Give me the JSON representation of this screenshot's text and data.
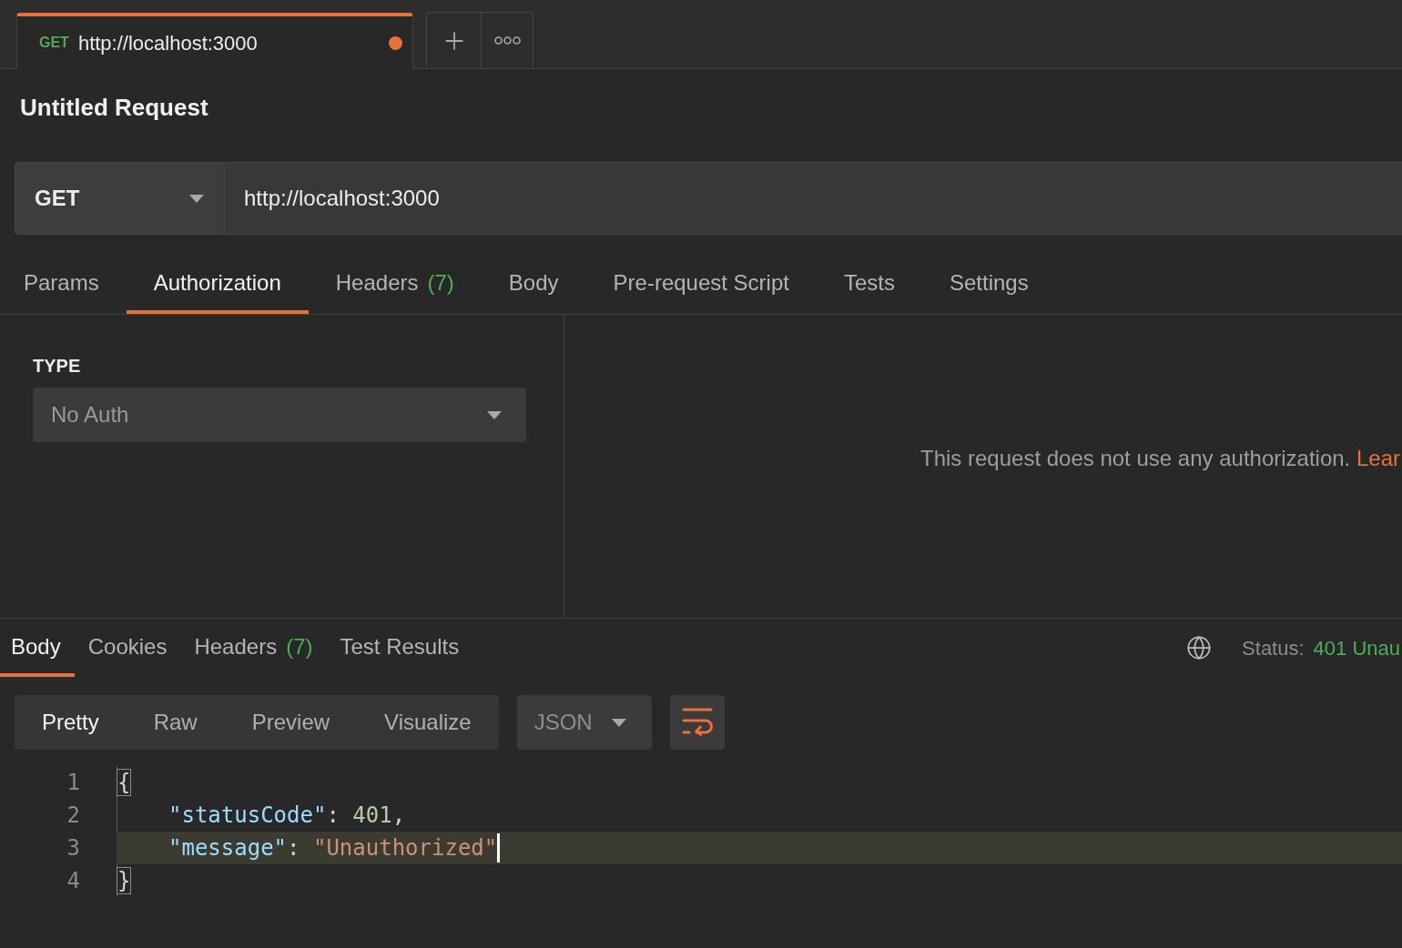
{
  "request_tabs": [
    {
      "method": "GET",
      "title": "http://localhost:3000",
      "unsaved": true,
      "selected": true
    }
  ],
  "request_title": "Untitled Request",
  "url_bar": {
    "method": "GET",
    "url": "http://localhost:3000"
  },
  "request_section_tabs": [
    {
      "label": "Params",
      "selected": false
    },
    {
      "label": "Authorization",
      "selected": true
    },
    {
      "label": "Headers",
      "count": "(7)",
      "selected": false
    },
    {
      "label": "Body",
      "selected": false
    },
    {
      "label": "Pre-request Script",
      "selected": false
    },
    {
      "label": "Tests",
      "selected": false
    },
    {
      "label": "Settings",
      "selected": false
    }
  ],
  "authorization": {
    "type_label": "TYPE",
    "type_value": "No Auth",
    "message": "This request does not use any authorization.",
    "link": "Lear"
  },
  "response_tabs": [
    {
      "label": "Body",
      "selected": true
    },
    {
      "label": "Cookies",
      "selected": false
    },
    {
      "label": "Headers",
      "count": "(7)",
      "selected": false
    },
    {
      "label": "Test Results",
      "selected": false
    }
  ],
  "response_status": {
    "label": "Status:",
    "value": "401 Unau"
  },
  "view_modes": [
    {
      "label": "Pretty",
      "selected": true
    },
    {
      "label": "Raw",
      "selected": false
    },
    {
      "label": "Preview",
      "selected": false
    },
    {
      "label": "Visualize",
      "selected": false
    }
  ],
  "format_select": {
    "value": "JSON"
  },
  "line_wrap": {
    "on": true
  },
  "code_lines": [
    {
      "number": "1",
      "indented": false,
      "active": false,
      "tokens": [
        {
          "kind": "brace_matched",
          "text": "{"
        }
      ]
    },
    {
      "number": "2",
      "indented": true,
      "active": false,
      "tokens": [
        {
          "kind": "key",
          "text": "\"statusCode\""
        },
        {
          "kind": "punct",
          "text": ": "
        },
        {
          "kind": "number",
          "text": "401"
        },
        {
          "kind": "punct",
          "text": ","
        }
      ]
    },
    {
      "number": "3",
      "indented": true,
      "active": true,
      "tokens": [
        {
          "kind": "key",
          "text": "\"message\""
        },
        {
          "kind": "punct",
          "text": ": "
        },
        {
          "kind": "string",
          "text": "\"Unauthorized\""
        }
      ]
    },
    {
      "number": "4",
      "indented": false,
      "active": false,
      "tokens": [
        {
          "kind": "brace_matched",
          "text": "}"
        }
      ]
    }
  ]
}
